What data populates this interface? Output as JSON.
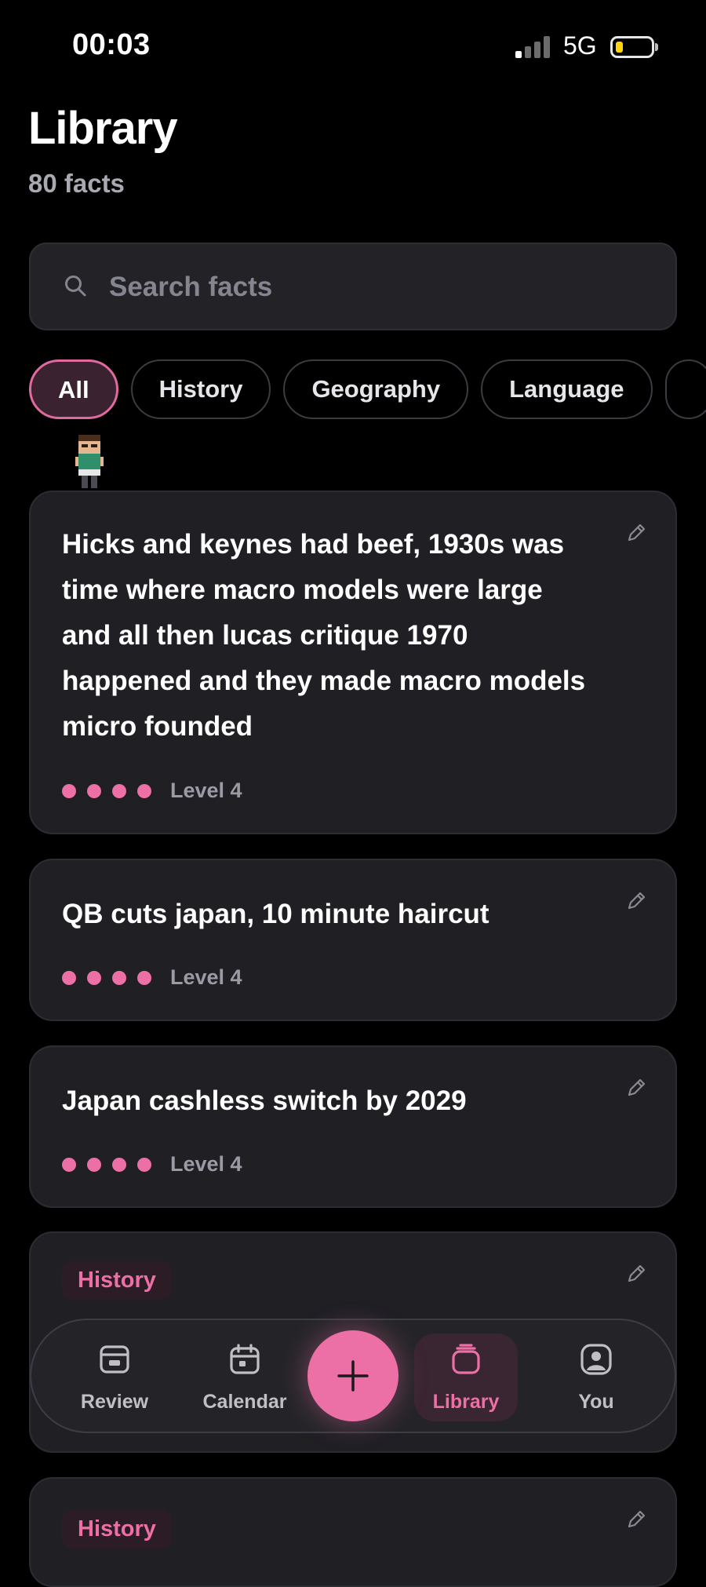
{
  "status_bar": {
    "time": "00:03",
    "network": "5G"
  },
  "header": {
    "title": "Library",
    "subtitle": "80 facts"
  },
  "search": {
    "placeholder": "Search facts",
    "value": ""
  },
  "filters": [
    "All",
    "History",
    "Geography",
    "Language"
  ],
  "active_filter": "All",
  "cards": [
    {
      "text": "Hicks and keynes had beef, 1930s was time where macro models were large and all then lucas critique 1970 happened and they made macro models micro founded",
      "level": "Level 4",
      "level_value": 4
    },
    {
      "text": "QB cuts japan, 10 minute haircut",
      "level": "Level 4",
      "level_value": 4
    },
    {
      "text": "Japan cashless switch by 2029",
      "level": "Level 4",
      "level_value": 4
    },
    {
      "tag": "History"
    },
    {
      "tag": "History"
    }
  ],
  "nav": {
    "items": [
      {
        "label": "Review",
        "icon": "review-icon"
      },
      {
        "label": "Calendar",
        "icon": "calendar-icon"
      },
      {
        "label": "Library",
        "icon": "library-icon"
      },
      {
        "label": "You",
        "icon": "person-icon"
      }
    ],
    "active": "Library",
    "add_icon": "plus-icon"
  },
  "colors": {
    "accent": "#ec6fa6",
    "background": "#000000",
    "card": "#1f1f24"
  }
}
